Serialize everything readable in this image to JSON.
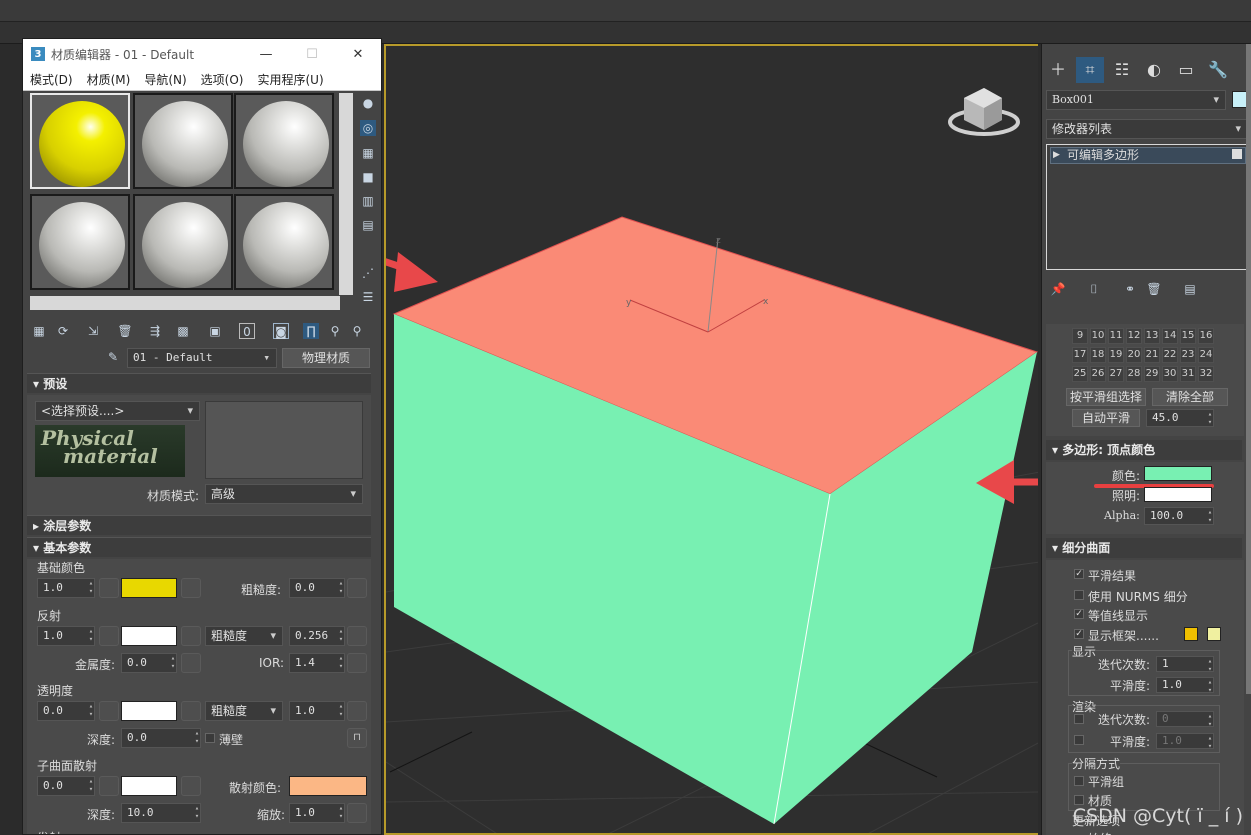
{
  "window": {
    "title": "材质编辑器 - 01 - Default",
    "logo": "3",
    "menu": [
      "模式(D)",
      "材质(M)",
      "导航(N)",
      "选项(O)",
      "实用程序(U)"
    ]
  },
  "slots": [
    "yellow",
    "white",
    "white",
    "white",
    "white",
    "white"
  ],
  "material_name": "01 - Default",
  "material_type_button": "物理材质",
  "presets": {
    "header": "预设",
    "select_placeholder": "<选择预设....>",
    "logo_line1": "Physical",
    "logo_line2": "material",
    "mode_label": "材质模式:",
    "mode_value": "高级"
  },
  "coating": {
    "header": "涂层参数"
  },
  "basic": {
    "header": "基本参数",
    "base_color": {
      "label": "基础颜色",
      "weight": "1.0",
      "color": "#e8d800",
      "roughness_label": "粗糙度:",
      "roughness": "0.0"
    },
    "reflection": {
      "label": "反射",
      "weight": "1.0",
      "color": "#ffffff",
      "mode": "粗糙度",
      "roughness": "0.256",
      "metalness_label": "金属度:",
      "metalness": "0.0",
      "ior_label": "IOR:",
      "ior": "1.4"
    },
    "transparency": {
      "label": "透明度",
      "weight": "0.0",
      "color": "#ffffff",
      "mode": "粗糙度",
      "roughness": "1.0",
      "depth_label": "深度:",
      "depth": "0.0",
      "thin_label": "薄壁"
    },
    "sss": {
      "label": "子曲面散射",
      "weight": "0.0",
      "color": "#ffffff",
      "scatter_label": "散射颜色:",
      "scatter_color": "#fbb785",
      "depth_label": "深度:",
      "depth": "10.0",
      "scale_label": "缩放:",
      "scale": "1.0"
    },
    "last_label": "发射"
  },
  "viewport": {
    "axis_labels": [
      "z",
      "y",
      "x"
    ],
    "box_top_color": "#fa8a76",
    "box_side_color": "#78f0b2"
  },
  "cmd": {
    "object_name": "Box001",
    "object_color": "#c8f0f8",
    "modifier_list": "修改器列表",
    "stack_item": "可编辑多边形",
    "smoothing_numbers": [
      [
        "9",
        "10",
        "11",
        "12",
        "13",
        "14",
        "15",
        "16"
      ],
      [
        "17",
        "18",
        "19",
        "20",
        "21",
        "22",
        "23",
        "24"
      ],
      [
        "25",
        "26",
        "27",
        "28",
        "29",
        "30",
        "31",
        "32"
      ]
    ],
    "select_by_sg": "按平滑组选择",
    "clear_all": "清除全部",
    "auto_smooth": "自动平滑",
    "auto_smooth_value": "45.0",
    "vertex_color_header": "多边形: 顶点颜色",
    "color_label": "颜色:",
    "vertex_color": "#78f0b2",
    "illum_label": "照明:",
    "illum_color": "#ffffff",
    "alpha_label": "Alpha:",
    "alpha": "100.0",
    "subdiv_header": "细分曲面",
    "smooth_result": "平滑结果",
    "use_nurms": "使用 NURMS 细分",
    "isoline": "等值线显示",
    "show_cage": "显示框架......",
    "cage_colors": [
      "#f0c000",
      "#f0f0a0"
    ],
    "display_label": "显示",
    "iterations_label": "迭代次数:",
    "iterations": "1",
    "smoothness_label": "平滑度:",
    "smoothness": "1.0",
    "render_label": "渲染",
    "render_iterations": "0",
    "render_smoothness": "1.0",
    "separate_label": "分隔方式",
    "sep_smoothing": "平滑组",
    "sep_material": "材质",
    "update_label": "更新选项",
    "update_always": "始终"
  },
  "watermark": "CSDN @Cyt( ï _ í )"
}
